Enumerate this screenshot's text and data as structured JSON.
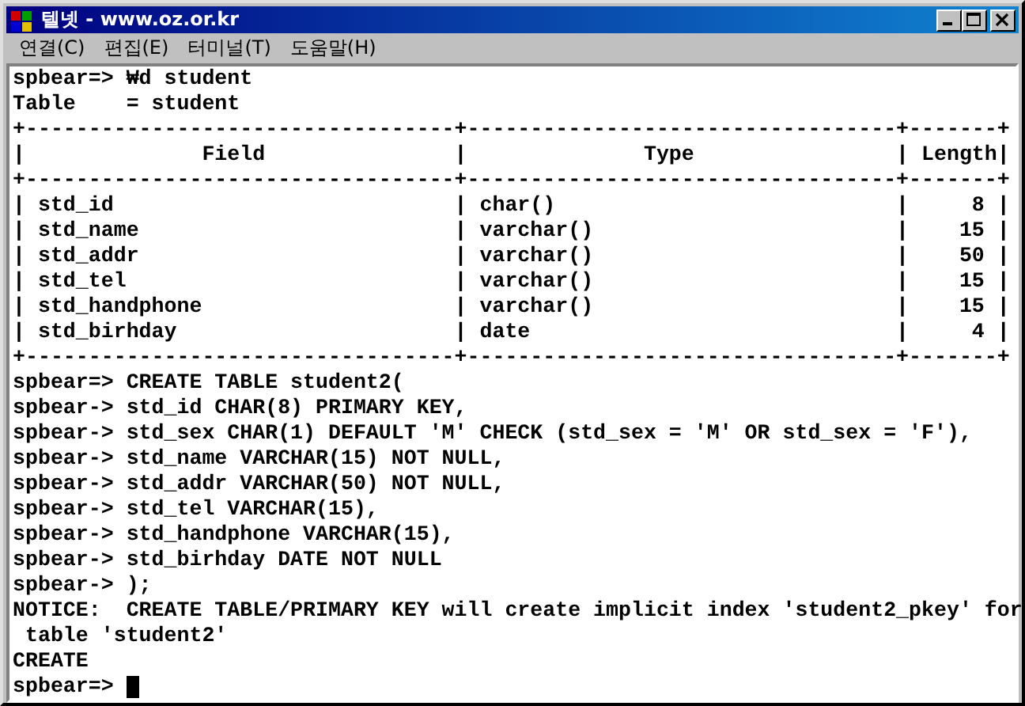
{
  "window": {
    "title": "텔넷 - www.oz.or.kr"
  },
  "menu": [
    "연결(C)",
    "편집(E)",
    "터미널(T)",
    "도움말(H)"
  ],
  "terminal": {
    "lines": [
      "spbear=> ₩d student",
      "Table    = student",
      "+----------------------------------+----------------------------------+-------+",
      "|              Field               |              Type                | Length|",
      "+----------------------------------+----------------------------------+-------+",
      "| std_id                           | char()                           |     8 |",
      "| std_name                         | varchar()                        |    15 |",
      "| std_addr                         | varchar()                        |    50 |",
      "| std_tel                          | varchar()                        |    15 |",
      "| std_handphone                    | varchar()                        |    15 |",
      "| std_birhday                      | date                             |     4 |",
      "+----------------------------------+----------------------------------+-------+",
      "spbear=> CREATE TABLE student2(",
      "spbear-> std_id CHAR(8) PRIMARY KEY,",
      "spbear-> std_sex CHAR(1) DEFAULT 'M' CHECK (std_sex = 'M' OR std_sex = 'F'),",
      "spbear-> std_name VARCHAR(15) NOT NULL,",
      "spbear-> std_addr VARCHAR(50) NOT NULL,",
      "spbear-> std_tel VARCHAR(15),",
      "spbear-> std_handphone VARCHAR(15),",
      "spbear-> std_birhday DATE NOT NULL",
      "spbear-> );",
      "NOTICE:  CREATE TABLE/PRIMARY KEY will create implicit index 'student2_pkey' for",
      " table 'student2'",
      "CREATE"
    ],
    "prompt": "spbear=> ",
    "cursor": true
  }
}
